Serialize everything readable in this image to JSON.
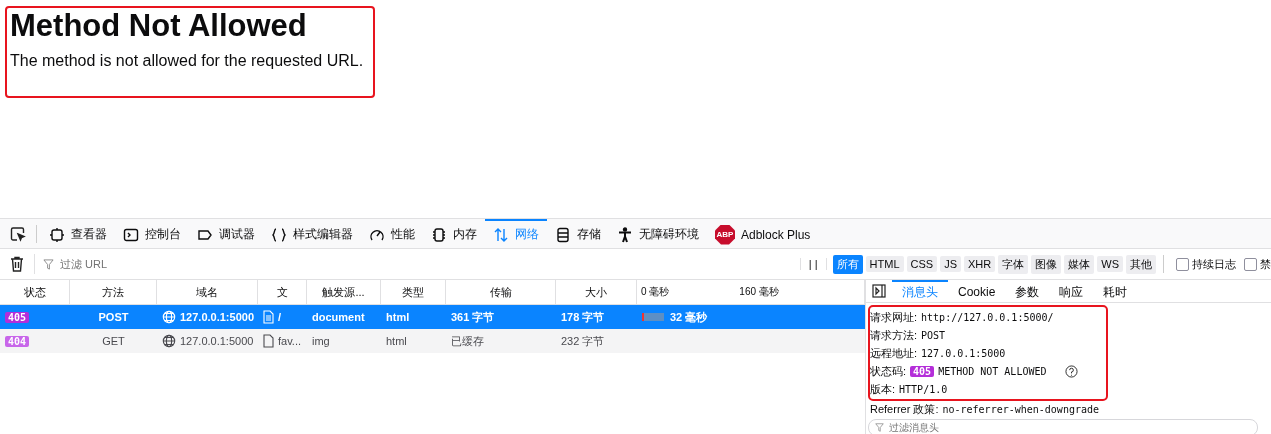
{
  "page": {
    "heading": "Method Not Allowed",
    "message": "The method is not allowed for the requested URL."
  },
  "toolbar": {
    "tabs": [
      {
        "kind": "inspector",
        "label": "查看器",
        "selected": false
      },
      {
        "kind": "console",
        "label": "控制台",
        "selected": false
      },
      {
        "kind": "debugger",
        "label": "调试器",
        "selected": false
      },
      {
        "kind": "style",
        "label": "样式编辑器",
        "selected": false
      },
      {
        "kind": "performance",
        "label": "性能",
        "selected": false
      },
      {
        "kind": "memory",
        "label": "内存",
        "selected": false
      },
      {
        "kind": "network",
        "label": "网络",
        "selected": true
      },
      {
        "kind": "storage",
        "label": "存储",
        "selected": false
      },
      {
        "kind": "accessibility",
        "label": "无障碍环境",
        "selected": false
      },
      {
        "kind": "adblock",
        "label": "Adblock Plus",
        "selected": false,
        "badge": "ABP"
      }
    ]
  },
  "filter_bar": {
    "placeholder": "过滤 URL",
    "pause": "| |",
    "types": [
      {
        "label": "所有",
        "selected": true
      },
      {
        "label": "HTML",
        "selected": false
      },
      {
        "label": "CSS",
        "selected": false
      },
      {
        "label": "JS",
        "selected": false
      },
      {
        "label": "XHR",
        "selected": false
      },
      {
        "label": "字体",
        "selected": false
      },
      {
        "label": "图像",
        "selected": false
      },
      {
        "label": "媒体",
        "selected": false
      },
      {
        "label": "WS",
        "selected": false
      },
      {
        "label": "其他",
        "selected": false
      }
    ],
    "options": [
      {
        "label": "持续日志",
        "checked": false
      },
      {
        "label": "禁",
        "checked": false
      }
    ]
  },
  "table": {
    "columns": [
      "状态",
      "方法",
      "域名",
      "文",
      "触发源...",
      "类型",
      "传输",
      "大小"
    ],
    "ticks": [
      "0 毫秒",
      "160 毫秒"
    ],
    "rows": [
      {
        "status": "405",
        "method": "POST",
        "domain": "127.0.0.1:5000",
        "file": {
          "kind": "document",
          "name": "/"
        },
        "cause": "document",
        "type": "html",
        "transferred": "361 字节",
        "size": "178 字节",
        "timing": "32 毫秒",
        "selected": true
      },
      {
        "status": "404",
        "method": "GET",
        "domain": "127.0.0.1:5000",
        "file": {
          "kind": "blank",
          "name": "fav..."
        },
        "cause": "img",
        "type": "html",
        "transferred": "已缓存",
        "size": "232 字节",
        "selected": false
      }
    ]
  },
  "details": {
    "tabs": [
      {
        "label": "消息头",
        "selected": true
      },
      {
        "label": "Cookie",
        "selected": false
      },
      {
        "label": "参数",
        "selected": false
      },
      {
        "label": "响应",
        "selected": false
      },
      {
        "label": "耗时",
        "selected": false
      }
    ],
    "fields": [
      {
        "kind": "text",
        "label": "请求网址:",
        "value": "http://127.0.0.1:5000/"
      },
      {
        "kind": "text",
        "label": "请求方法:",
        "value": "POST"
      },
      {
        "kind": "text",
        "label": "远程地址:",
        "value": "127.0.0.1:5000"
      },
      {
        "kind": "status",
        "label": "状态码:",
        "code": "405",
        "value": "METHOD NOT ALLOWED"
      },
      {
        "kind": "text",
        "label": "版本:",
        "value": "HTTP/1.0"
      }
    ],
    "referrer": {
      "label": "Referrer 政策:",
      "value": "no-referrer-when-downgrade"
    },
    "filter": {
      "placeholder": "过滤消息头"
    }
  }
}
